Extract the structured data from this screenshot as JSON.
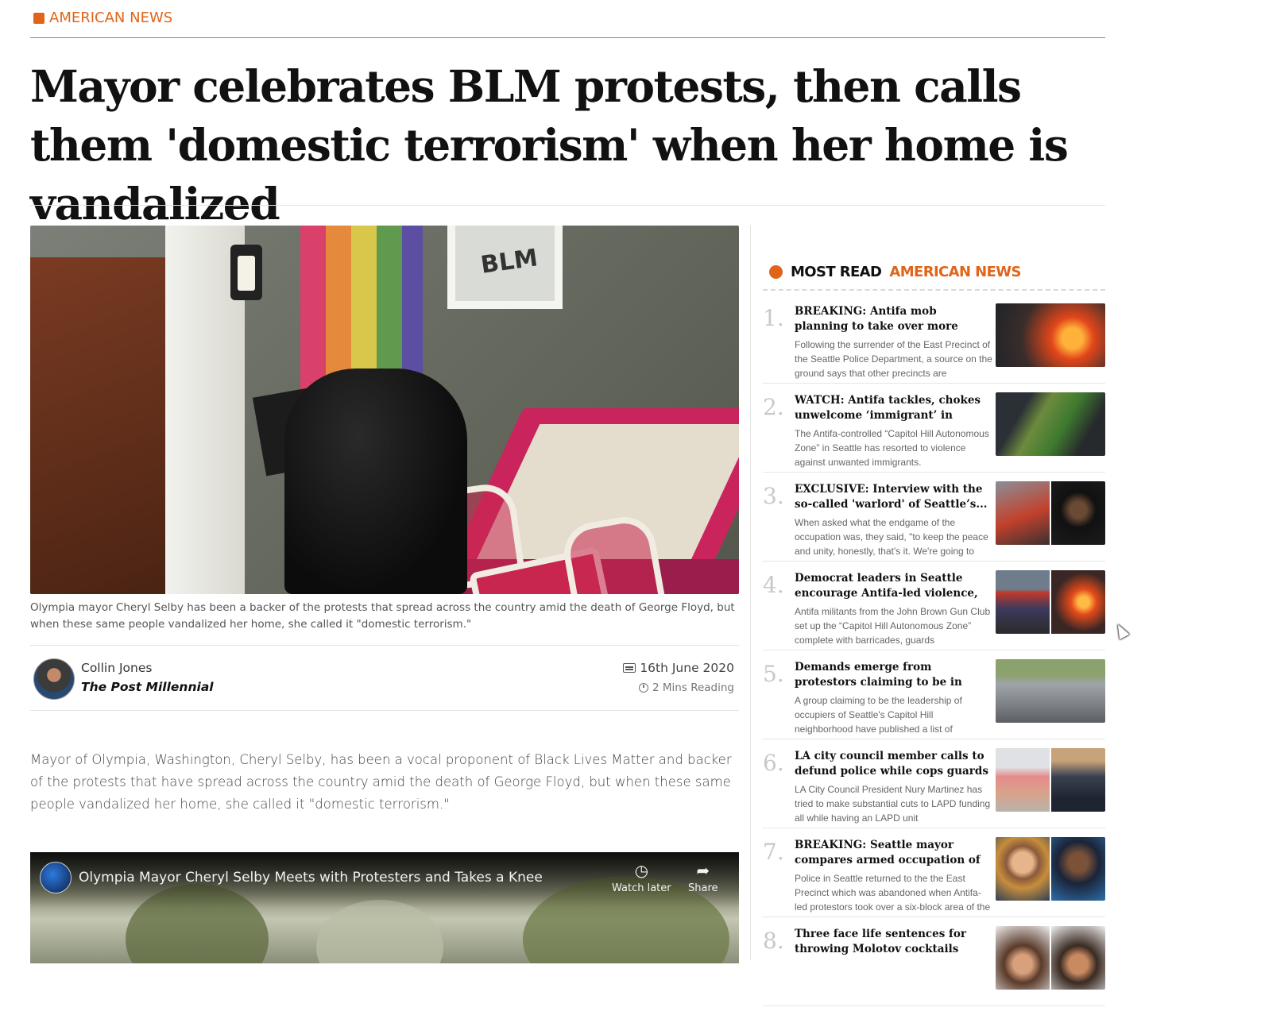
{
  "section": {
    "label": "AMERICAN NEWS",
    "color": "#e0651a"
  },
  "article": {
    "headline": "Mayor celebrates BLM protests, then calls them 'domestic terrorism' when her home is vandalized",
    "image_caption": "Olympia mayor Cheryl Selby has been a backer of the protests that spread across the country amid the death of George Floyd, but when these same people vandalized her home, she called it \"domestic terrorism.\"",
    "image_sign_text": "BLM",
    "author": "Collin Jones",
    "outlet": "The Post Millennial",
    "date": "16th June 2020",
    "reading_time": "2 Mins Reading",
    "body": "Mayor of Olympia, Washington, Cheryl Selby, has been a vocal proponent of Black Lives Matter and backer of the protests that have spread across the country amid the death of George Floyd, but when these same people vandalized her home, she called it \"domestic terrorism.\""
  },
  "video": {
    "title": "Olympia Mayor Cheryl Selby Meets with Protesters and Takes a Knee",
    "watch_later_label": "Watch later",
    "share_label": "Share"
  },
  "most_read": {
    "heading_a": "MOST READ",
    "heading_b": "AMERICAN NEWS",
    "items": [
      {
        "num": "1.",
        "title": "BREAKING: Antifa mob planning to take over more Seattle neighbourhoods",
        "excerpt": "Following the surrender of the East Precinct of the Seattle Police Department, a source on the ground says that other precincts are"
      },
      {
        "num": "2.",
        "title": "WATCH: Antifa tackles, chokes unwelcome ‘immigrant’ in autonomo...",
        "excerpt": "The Antifa-controlled “Capitol Hill Autonomous Zone” in Seattle has resorted to violence against unwanted immigrants."
      },
      {
        "num": "3.",
        "title": "EXCLUSIVE: Interview with the so-called 'warlord' of Seattle’s...",
        "excerpt": "When asked what the endgame of the occupation was, they said, \"to keep the peace and unity, honestly, that's it. We're going to"
      },
      {
        "num": "4.",
        "title": "Democrat leaders in Seattle encourage Antifa-led violence, takeover of...",
        "excerpt": "Antifa militants from the John Brown Gun Club set up the “Capitol Hill Autonomous Zone” complete with barricades, guards"
      },
      {
        "num": "5.",
        "title": "Demands emerge from protestors claiming to be in Seattle's Capital Hi...",
        "excerpt": "A group claiming to be the leadership of occupiers of Seattle's Capitol Hill neighborhood have published a list of"
      },
      {
        "num": "6.",
        "title": "LA city council member calls to defund police while cops guards her house",
        "excerpt": "LA City Council President Nury Martinez has tried to make substantial cuts to LAPD funding all while having an LAPD unit"
      },
      {
        "num": "7.",
        "title": "BREAKING: Seattle mayor compares armed occupation of her own city to a...",
        "excerpt": "Police in Seattle returned to the the East Precinct which was abandoned when Antifa-led protestors took over a six-block area of the"
      },
      {
        "num": "8.",
        "title": "Three face life sentences for throwing Molotov cocktails during riots in Ne...",
        "excerpt": ""
      }
    ]
  }
}
